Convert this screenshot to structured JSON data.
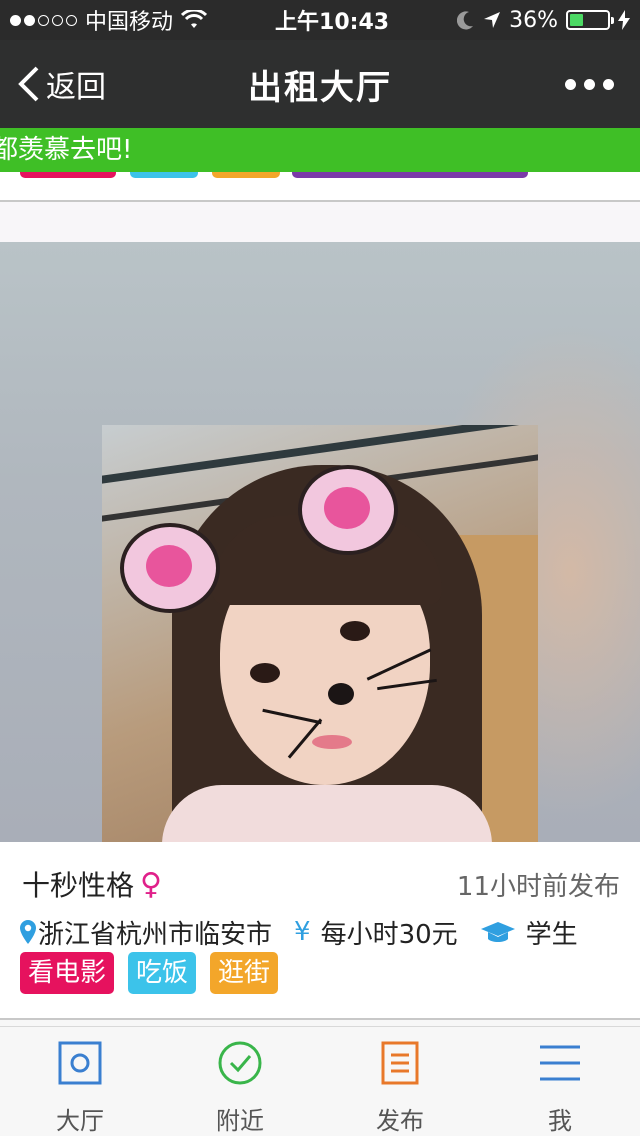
{
  "status_bar": {
    "carrier": "中国移动",
    "time": "上午10:43",
    "battery": "36%",
    "battery_level": 0.36,
    "icons": [
      "signal-dots",
      "wifi-icon",
      "moon-icon",
      "location-arrow-icon",
      "battery-icon",
      "charging-bolt-icon"
    ]
  },
  "nav": {
    "back_label": "返回",
    "title": "出租大厅",
    "more_icon": "more-dots-icon"
  },
  "marquee": {
    "text": "都羡慕去吧!"
  },
  "card": {
    "name": "十秒性格",
    "gender_symbol": "♀",
    "posted": "11小时前发布",
    "location": "浙江省杭州市临安市",
    "price": "每小时30元",
    "occupation": "学生",
    "tags": [
      {
        "label": "看电影",
        "color": "#e6125e"
      },
      {
        "label": "吃饭",
        "color": "#3cc3ea"
      },
      {
        "label": "逛街",
        "color": "#f3a62a"
      }
    ]
  },
  "tab_bar": {
    "items": [
      {
        "label": "大厅",
        "icon": "hall-icon"
      },
      {
        "label": "附近",
        "icon": "check-circle-icon"
      },
      {
        "label": "发布",
        "icon": "document-icon"
      },
      {
        "label": "我",
        "icon": "menu-lines-icon"
      }
    ]
  },
  "colors": {
    "banner_green": "#3fbf26",
    "nav_dark": "#2e2f2f",
    "accent_blue": "#2f9fe0",
    "female_pink": "#e0208a"
  }
}
